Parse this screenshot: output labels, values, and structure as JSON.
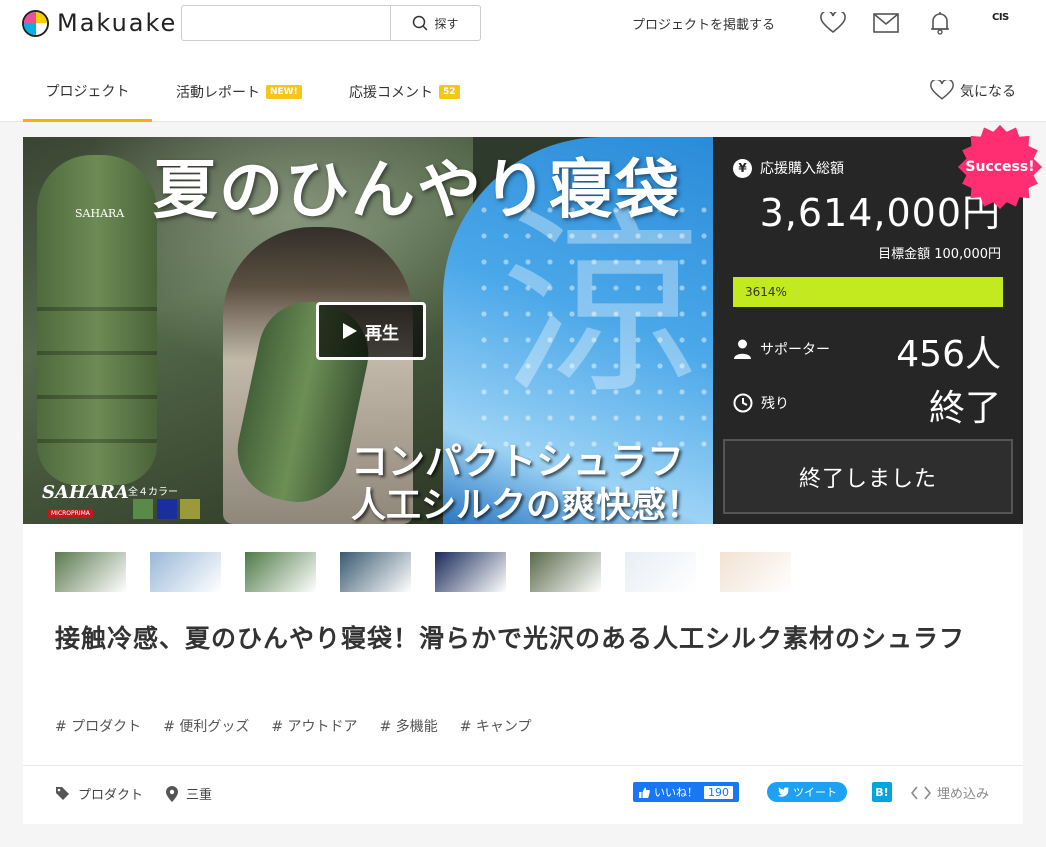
{
  "header": {
    "logo_text": "Makuake",
    "search_placeholder": "",
    "search_button": "探す",
    "publish_link": "プロジェクトを掲載する",
    "avatar_text": "CIS"
  },
  "tabs": [
    {
      "label": "プロジェクト",
      "badge": ""
    },
    {
      "label": "活動レポート",
      "badge": "NEW!"
    },
    {
      "label": "応援コメント",
      "badge": "52"
    }
  ],
  "favorite_label": "気になる",
  "hero": {
    "title": "夏のひんやり寝袋",
    "kanji": "涼",
    "subtitle_1": "コンパクトシュラフ",
    "subtitle_2": "人工シルクの爽快感！",
    "play_label": "再生",
    "brand": "SAHARA",
    "bag_label": "SAHARA",
    "brand_tag": "MICROPRIMA",
    "colors_label": "全４カラー",
    "swatches": [
      "#5a8a4a",
      "#1a2ea0",
      "#9a9a3a"
    ]
  },
  "stats": {
    "total_label": "応援購入総額",
    "total_value": "3,614,000円",
    "goal_text": "目標金額 100,000円",
    "progress_text": "3614%",
    "progress_percent": 3614,
    "supporters_label": "サポーター",
    "supporters_value": "456人",
    "remaining_label": "残り",
    "remaining_value": "終了",
    "ended_button": "終了しました",
    "success_badge": "Success!"
  },
  "thumbnails": [
    {
      "name": "thumb-1",
      "color": "#5c7a50"
    },
    {
      "name": "thumb-2",
      "color": "#9ab8d8"
    },
    {
      "name": "thumb-3",
      "color": "#4e7a46"
    },
    {
      "name": "thumb-4",
      "color": "#3a5a70"
    },
    {
      "name": "thumb-5",
      "color": "#1a2a5a"
    },
    {
      "name": "thumb-6",
      "color": "#5a6a4a"
    },
    {
      "name": "thumb-7",
      "color": "#e8eef4"
    },
    {
      "name": "thumb-8",
      "color": "#f2e2d2"
    }
  ],
  "project": {
    "title": "接触冷感、夏のひんやり寝袋！滑らかで光沢のある人工シルク素材のシュラフ",
    "tags": [
      "# プロダクト",
      "# 便利グッズ",
      "# アウトドア",
      "# 多機能",
      "# キャンプ"
    ],
    "category": "プロダクト",
    "location": "三重"
  },
  "social": {
    "fb_label": "いいね！",
    "fb_count": "190",
    "tweet_label": "ツイート",
    "hatena_label": "B!",
    "embed_label": "埋め込み"
  }
}
